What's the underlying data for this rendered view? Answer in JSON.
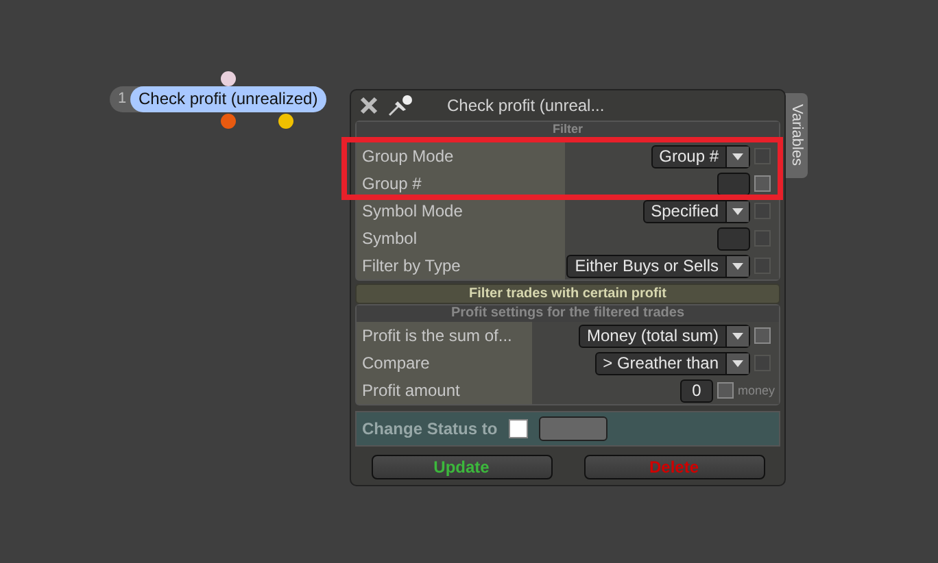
{
  "node": {
    "number": "1",
    "label": "Check profit (unrealized)",
    "ports": [
      {
        "color": "#e8d0dc"
      },
      {
        "color": "#e85a10"
      },
      {
        "color": "#f0c000"
      }
    ]
  },
  "panel": {
    "title": "Check profit (unreal...",
    "side_tab": "Variables"
  },
  "filter": {
    "title": "Filter",
    "rows": [
      {
        "label": "Group Mode",
        "kind": "dropdown",
        "value": "Group #",
        "checkbox": {
          "enabled": false,
          "checked": false
        }
      },
      {
        "label": "Group #",
        "kind": "input",
        "checkbox": {
          "enabled": true,
          "checked": false
        }
      },
      {
        "label": "Symbol Mode",
        "kind": "dropdown",
        "value": "Specified",
        "checkbox": {
          "enabled": false,
          "checked": false
        }
      },
      {
        "label": "Symbol",
        "kind": "input",
        "checkbox": {
          "enabled": false,
          "checked": false
        }
      },
      {
        "label": "Filter by Type",
        "kind": "dropdown",
        "value": "Either Buys or Sells",
        "checkbox": {
          "enabled": false,
          "checked": false
        }
      }
    ]
  },
  "section_bar": "Filter trades with certain profit",
  "profit": {
    "title": "Profit settings for the filtered trades",
    "rows": [
      {
        "label": "Profit is the sum of...",
        "kind": "dropdown",
        "value": "Money (total sum)",
        "checkbox": {
          "enabled": true,
          "checked": false
        }
      },
      {
        "label": "Compare",
        "kind": "dropdown",
        "value": "> Greather than",
        "checkbox": {
          "enabled": false,
          "checked": false
        }
      },
      {
        "label": "Profit amount",
        "kind": "input",
        "value": "0",
        "unit": "money",
        "checkbox": {
          "enabled": true,
          "checked": false
        }
      }
    ]
  },
  "change_status": {
    "label": "Change Status to",
    "checked": false
  },
  "buttons": [
    {
      "label": "Update",
      "kind": "update"
    },
    {
      "label": "Delete",
      "kind": "delete"
    }
  ]
}
